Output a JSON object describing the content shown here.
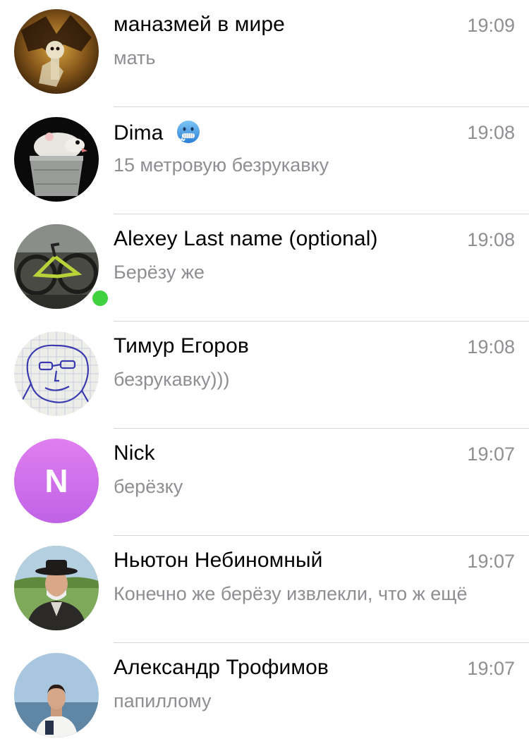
{
  "colors": {
    "online": "#3fd13f",
    "nick_avatar": "#c76ae8",
    "secondary_text": "#8e8e93"
  },
  "chats": [
    {
      "name": "маназмей в мире",
      "time": "19:09",
      "preview": "мать",
      "avatar": "dark-illustration-avatar"
    },
    {
      "name": "Dima",
      "name_icon": "freezing-face-icon",
      "time": "19:08",
      "preview": "15 метровую безрукавку",
      "avatar": "opossum-in-bucket-avatar"
    },
    {
      "name": "Alexey Last name (optional)",
      "time": "19:08",
      "preview": "Берёзу же",
      "avatar": "bicycle-photo-avatar",
      "online": true
    },
    {
      "name": "Тимур Егоров",
      "time": "19:08",
      "preview": "безрукавку)))",
      "avatar": "doodle-face-avatar"
    },
    {
      "name": "Nick",
      "time": "19:07",
      "preview": "берёзку",
      "avatar_initial": "N"
    },
    {
      "name": "Ньютон Небиномный",
      "time": "19:07",
      "preview": "Конечно же берёзу извлекли, что ж ещё",
      "avatar": "man-in-hat-photo-avatar"
    },
    {
      "name": "Александр Трофимов",
      "time": "19:07",
      "preview": "папиллому",
      "avatar": "young-man-photo-avatar"
    }
  ]
}
